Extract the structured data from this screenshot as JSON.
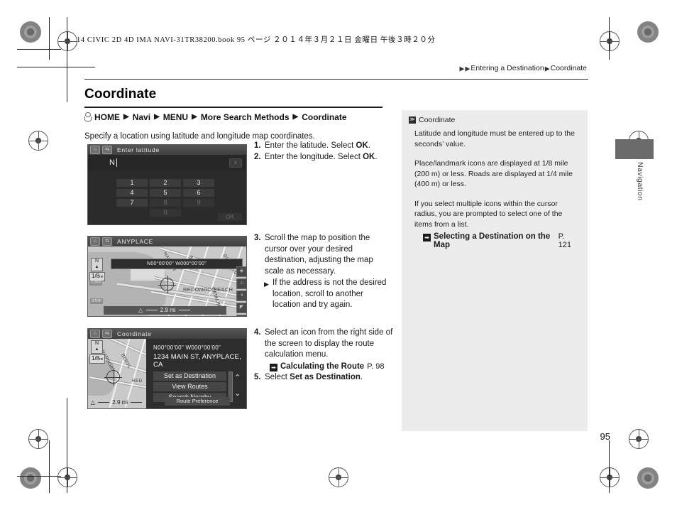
{
  "print": {
    "book_line": "14 CIVIC 2D 4D IMA NAVI-31TR38200.book  95 ページ   ２０１４年３月２１日  金曜日  午後３時２０分"
  },
  "breadcrumb": {
    "arrow": "▶",
    "section": "Entering a Destination",
    "topic": "Coordinate"
  },
  "page": {
    "title": "Coordinate",
    "number": "95",
    "side_tab_label": "Navigation"
  },
  "navpath": {
    "home_label": "HOME",
    "triangle": "▶",
    "items": [
      "Navi",
      "MENU",
      "More Search Methods",
      "Coordinate"
    ]
  },
  "intro": "Specify a location using latitude and longitude map coordinates.",
  "steps": [
    {
      "num": "1.",
      "text_before": "Enter the latitude. Select ",
      "bold": "OK",
      "text_after": "."
    },
    {
      "num": "2.",
      "text_before": "Enter the longitude. Select ",
      "bold": "OK",
      "text_after": "."
    },
    {
      "num": "3.",
      "text": "Scroll the map to position the cursor over your desired destination, adjusting the map scale as necessary.",
      "bullet_triangle": "▶",
      "bullet": "If the address is not the desired location, scroll to another location and try again."
    },
    {
      "num": "4.",
      "text": "Select an icon from the right side of the screen to display the route calculation menu.",
      "xref_icon": "➡",
      "xref_title": "Calculating the Route",
      "xref_page": "P. 98"
    },
    {
      "num": "5.",
      "text_before": "Select ",
      "bold": "Set as Destination",
      "text_after": "."
    }
  ],
  "screens": {
    "keypad": {
      "title": "Enter latitude",
      "home_icon": "⌂",
      "back_icon": "⇆",
      "input_value": "N",
      "delete_label": "x",
      "keys": [
        [
          {
            "label": "1",
            "enabled": true
          },
          {
            "label": "2",
            "enabled": true
          },
          {
            "label": "3",
            "enabled": true
          }
        ],
        [
          {
            "label": "4",
            "enabled": true
          },
          {
            "label": "5",
            "enabled": true
          },
          {
            "label": "6",
            "enabled": true
          }
        ],
        [
          {
            "label": "7",
            "enabled": true
          },
          {
            "label": "8",
            "enabled": false
          },
          {
            "label": "9",
            "enabled": false
          }
        ]
      ],
      "zero_key": "0",
      "ok_label": "OK"
    },
    "map": {
      "title": "ANYPLACE",
      "home_icon": "⌂",
      "back_icon": "⇆",
      "coordinates": "N00°00'00\" W000°00'00\"",
      "compass_letter": "N",
      "compass_tri": "▲",
      "scale": "1/8",
      "scale_unit": "mi",
      "scale_sub": "CURS",
      "corner_badge": "STRF",
      "distance": "2.9 mi",
      "distance_icon": "△",
      "place_label": "REDONDO BEACH",
      "street_labels": [
        "HARBOR",
        "BERYL",
        "DIAMOND",
        "CATALINA"
      ],
      "tools": [
        "layers-icon",
        "poi-icon",
        "contrast-icon",
        "route-icon",
        "info-icon"
      ]
    },
    "detail": {
      "title": "Coordinate",
      "home_icon": "⌂",
      "back_icon": "⇆",
      "coordinates": "N00°00'00\" W000°00'00\"",
      "address": "1234 MAIN ST, ANYPLACE, CA",
      "menu_items": [
        "Set as Destination",
        "View Routes",
        "Search Nearby"
      ],
      "chevron_up": "⌃",
      "chevron_down": "⌄",
      "route_pref_label": "Route Preference",
      "scale": "1/8",
      "scale_unit": "mi",
      "distance": "2.9 mi",
      "distance_icon": "△",
      "compass_letter": "N",
      "compass_tri": "▲",
      "map_label": "RED"
    }
  },
  "note": {
    "icon": "≫",
    "heading": "Coordinate",
    "paragraphs": [
      "Latitude and longitude must be entered up to the seconds’ value.",
      "Place/landmark icons are displayed at 1/8 mile (200 m) or less. Roads are displayed at 1/4 mile (400 m) or less.",
      "If you select multiple icons within the cursor radius, you are prompted to select one of the items from a list."
    ],
    "xref_icon": "➡",
    "xref_title": "Selecting a Destination on the Map",
    "xref_page": "P. 121"
  }
}
